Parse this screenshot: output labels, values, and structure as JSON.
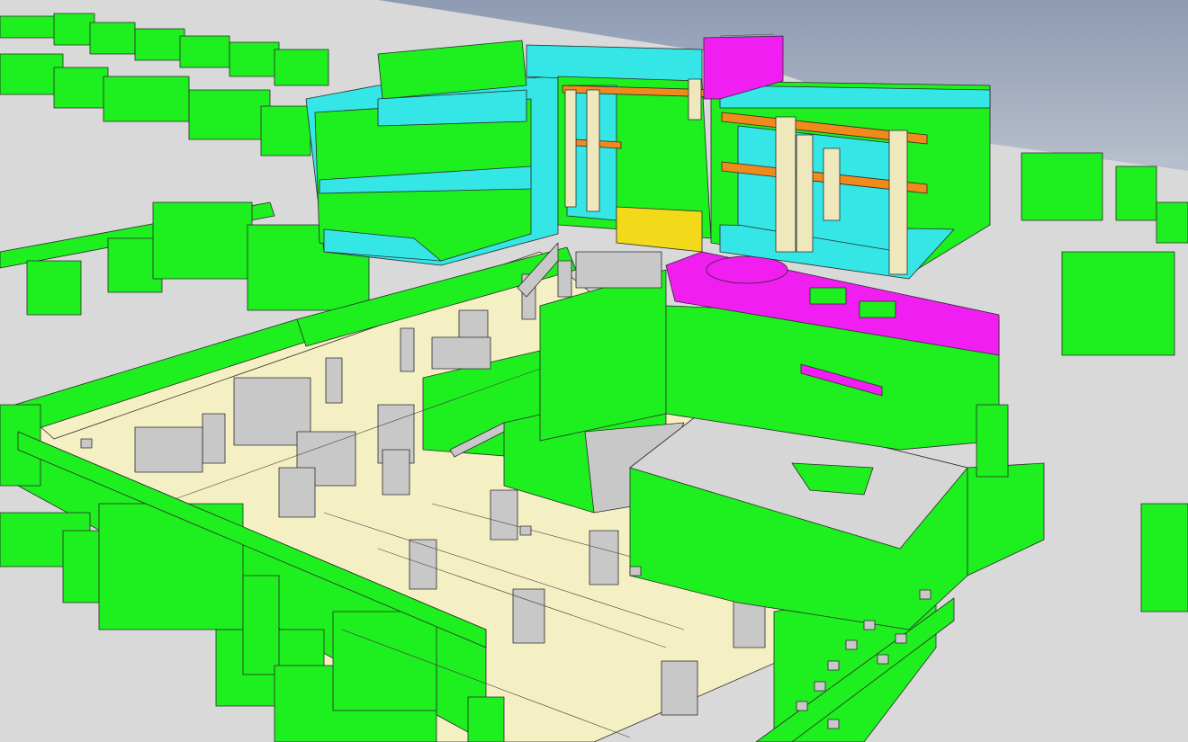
{
  "colors": {
    "sky_top": "#8e9bb3",
    "sky_bottom": "#b9c0cd",
    "ground": "#d9d9d9",
    "foundation": "#1eef1e",
    "foundation_dark": "#13c313",
    "glass": "#35e6e6",
    "slab": "#f5f0c4",
    "column_grey": "#c8c8c8",
    "column_cream": "#efe8bd",
    "beam_orange": "#f18a1c",
    "magenta": "#f01ef0",
    "yellow": "#f2d919",
    "edge": "#2a2a2a"
  }
}
